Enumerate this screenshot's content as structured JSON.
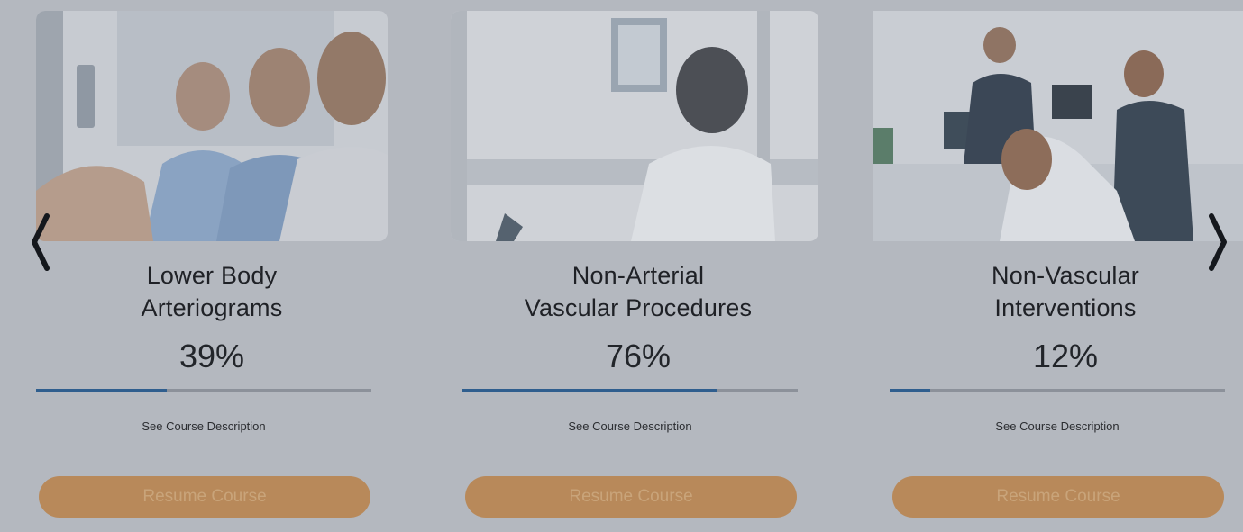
{
  "carousel": {
    "prev_icon": "chevron-left-icon",
    "next_icon": "chevron-right-icon",
    "colors": {
      "overlay_background": "#b4b8bf",
      "progress_fill": "#2f5e8e",
      "button_background": "#b8895a",
      "button_text": "#c9a47a"
    }
  },
  "courses": [
    {
      "title": "Lower Body\nArteriograms",
      "percent_label": "39%",
      "progress": 39,
      "link_label": "See Course Description",
      "button_label": "Resume Course"
    },
    {
      "title": "Non-Arterial\nVascular Procedures",
      "percent_label": "76%",
      "progress": 76,
      "link_label": "See Course Description",
      "button_label": "Resume Course"
    },
    {
      "title": "Non-Vascular\nInterventions",
      "percent_label": "12%",
      "progress": 12,
      "link_label": "See Course Description",
      "button_label": "Resume Course"
    }
  ]
}
